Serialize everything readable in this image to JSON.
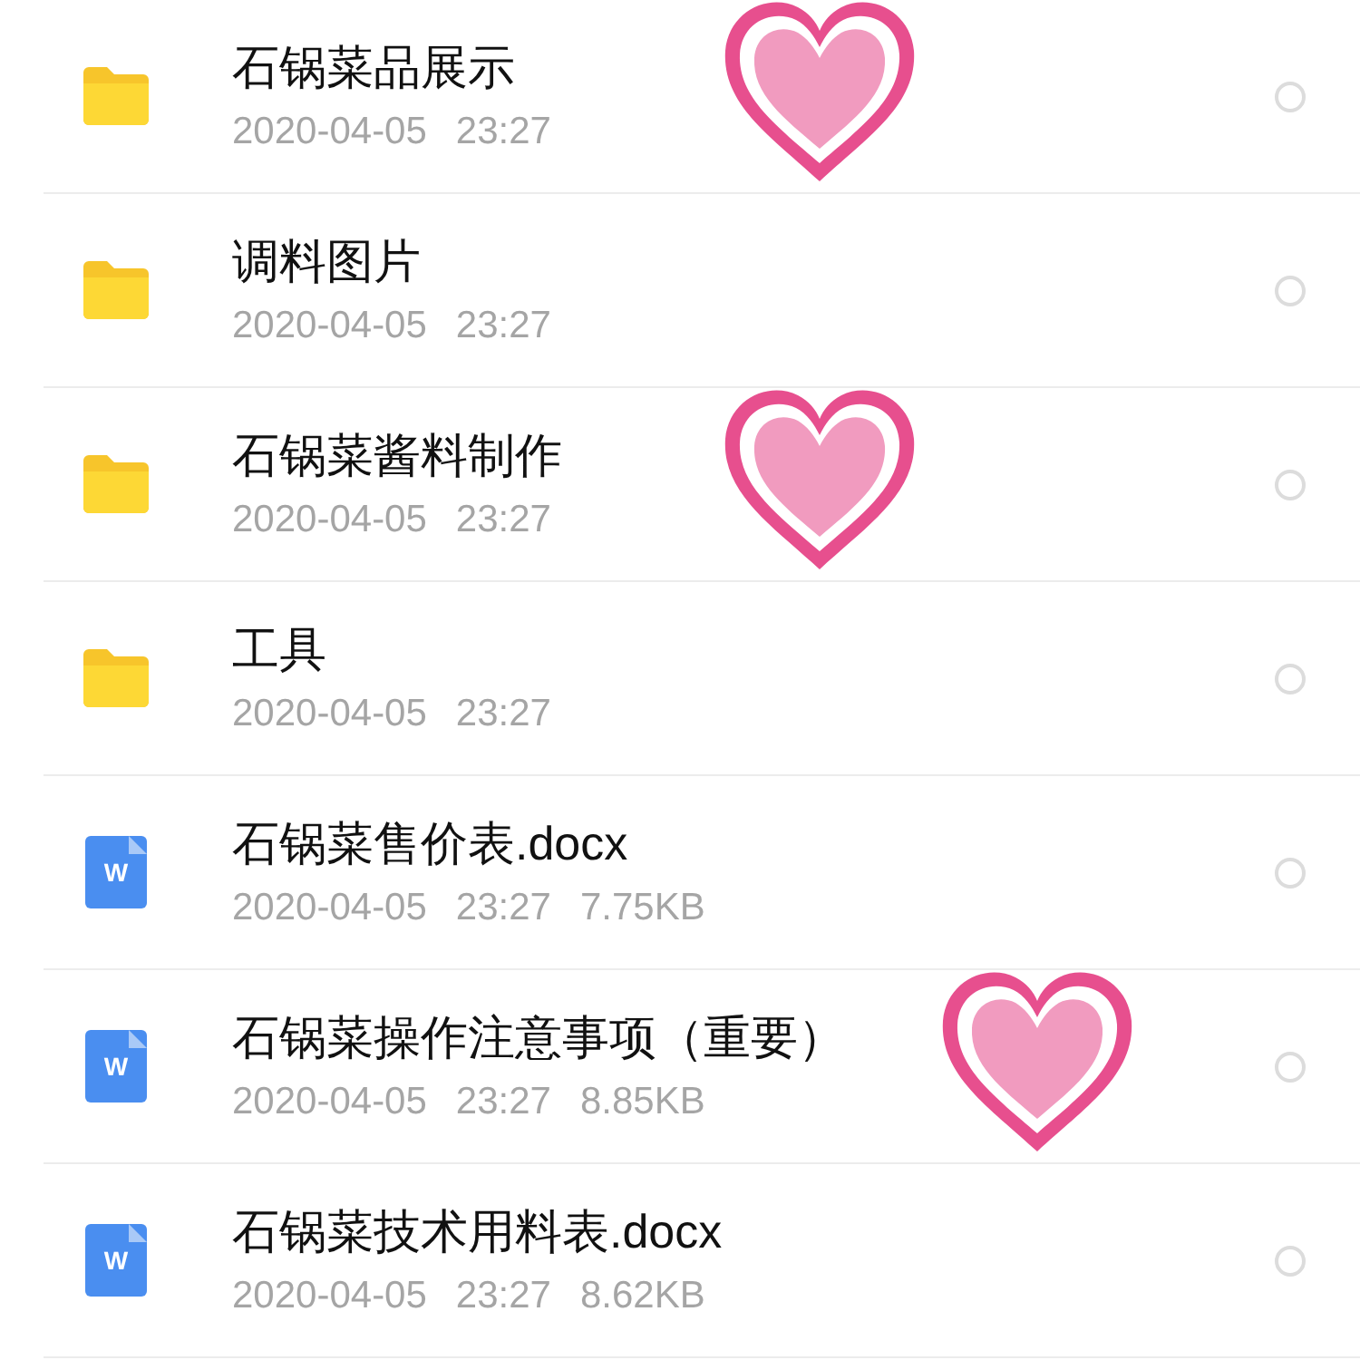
{
  "files": [
    {
      "kind": "folder",
      "name": "石锅菜品展示",
      "date": "2020-04-05",
      "time": "23:27",
      "sticker": true,
      "selected": false
    },
    {
      "kind": "folder",
      "name": "调料图片",
      "date": "2020-04-05",
      "time": "23:27",
      "sticker": false,
      "selected": false
    },
    {
      "kind": "folder",
      "name": "石锅菜酱料制作",
      "date": "2020-04-05",
      "time": "23:27",
      "sticker": true,
      "selected": false
    },
    {
      "kind": "folder",
      "name": "工具",
      "date": "2020-04-05",
      "time": "23:27",
      "sticker": false,
      "selected": false
    },
    {
      "kind": "doc",
      "badge": "W",
      "name": "石锅菜售价表.docx",
      "date": "2020-04-05",
      "time": "23:27",
      "size": "7.75KB",
      "sticker": false,
      "selected": false
    },
    {
      "kind": "doc",
      "badge": "W",
      "name": "石锅菜操作注意事项（重要）",
      "date": "2020-04-05",
      "time": "23:27",
      "size": "8.85KB",
      "sticker": true,
      "selected": false
    },
    {
      "kind": "doc",
      "badge": "W",
      "name": "石锅菜技术用料表.docx",
      "date": "2020-04-05",
      "time": "23:27",
      "size": "8.62KB",
      "sticker": false,
      "selected": false
    }
  ]
}
